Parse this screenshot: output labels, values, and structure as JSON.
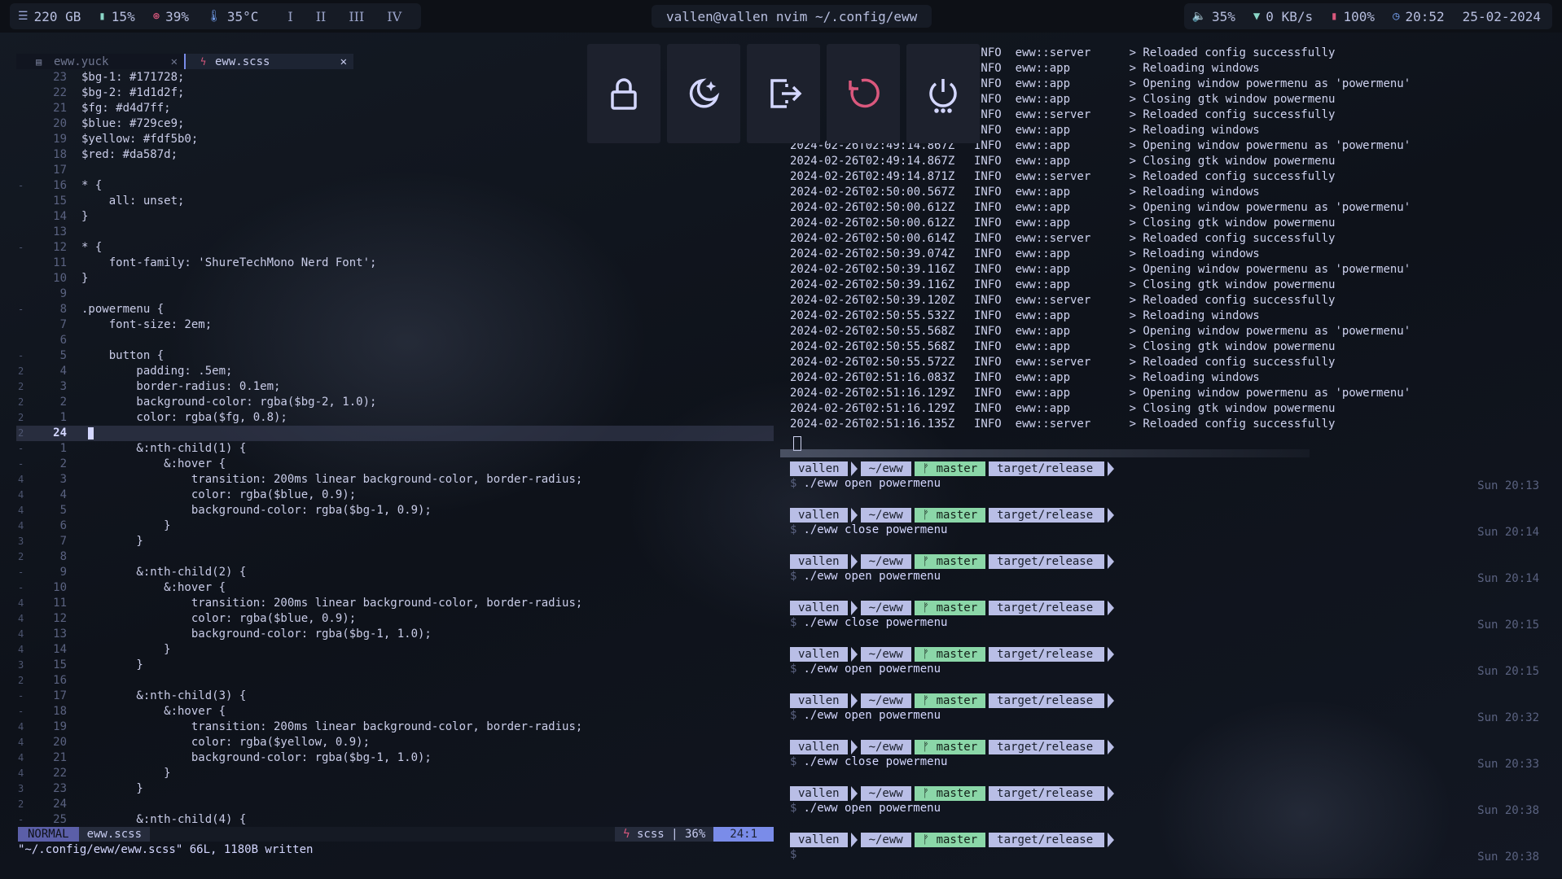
{
  "topbar": {
    "disk": "220 GB",
    "ram": "15%",
    "cpu": "39%",
    "temp": "35°C",
    "workspaces": [
      "I",
      "II",
      "III",
      "IV"
    ],
    "window_title": "vallen@vallen nvim ~/.config/eww",
    "volume": "35%",
    "network": "0 KB/s",
    "battery": "100%",
    "time": "20:52",
    "date": "25-02-2024"
  },
  "editor": {
    "tabs": [
      {
        "label": "eww.yuck",
        "close": "✕"
      },
      {
        "label": "eww.scss",
        "close": "✕"
      }
    ],
    "lines": [
      {
        "sign": "",
        "num": "23",
        "text": "$bg-1: #171728;"
      },
      {
        "sign": "",
        "num": "22",
        "text": "$bg-2: #1d1d2f;"
      },
      {
        "sign": "",
        "num": "21",
        "text": "$fg: #d4d7ff;"
      },
      {
        "sign": "",
        "num": "20",
        "text": "$blue: #729ce9;"
      },
      {
        "sign": "",
        "num": "19",
        "text": "$yellow: #fdf5b0;"
      },
      {
        "sign": "",
        "num": "18",
        "text": "$red: #da587d;"
      },
      {
        "sign": "",
        "num": "17",
        "text": ""
      },
      {
        "sign": "-",
        "num": "16",
        "text": "* {"
      },
      {
        "sign": "",
        "num": "15",
        "text": "    all: unset;"
      },
      {
        "sign": "",
        "num": "14",
        "text": "}"
      },
      {
        "sign": "",
        "num": "13",
        "text": ""
      },
      {
        "sign": "-",
        "num": "12",
        "text": "* {"
      },
      {
        "sign": "",
        "num": "11",
        "text": "    font-family: 'ShureTechMono Nerd Font';"
      },
      {
        "sign": "",
        "num": "10",
        "text": "}"
      },
      {
        "sign": "",
        "num": "9",
        "text": ""
      },
      {
        "sign": "-",
        "num": "8",
        "text": ".powermenu {"
      },
      {
        "sign": "",
        "num": "7",
        "text": "    font-size: 2em;"
      },
      {
        "sign": "",
        "num": "6",
        "text": ""
      },
      {
        "sign": "-",
        "num": "5",
        "text": "    button {"
      },
      {
        "sign": "2",
        "num": "4",
        "text": "        padding: .5em;"
      },
      {
        "sign": "2",
        "num": "3",
        "text": "        border-radius: 0.1em;"
      },
      {
        "sign": "2",
        "num": "2",
        "text": "        background-color: rgba($bg-2, 1.0);"
      },
      {
        "sign": "2",
        "num": "1",
        "text": "        color: rgba($fg, 0.8);"
      },
      {
        "sign": "2",
        "num": "24",
        "text": "",
        "current": true
      },
      {
        "sign": "-",
        "num": "1",
        "text": "        &:nth-child(1) {"
      },
      {
        "sign": "-",
        "num": "2",
        "text": "            &:hover {"
      },
      {
        "sign": "4",
        "num": "3",
        "text": "                transition: 200ms linear background-color, border-radius;"
      },
      {
        "sign": "4",
        "num": "4",
        "text": "                color: rgba($blue, 0.9);"
      },
      {
        "sign": "4",
        "num": "5",
        "text": "                background-color: rgba($bg-1, 0.9);"
      },
      {
        "sign": "4",
        "num": "6",
        "text": "            }"
      },
      {
        "sign": "3",
        "num": "7",
        "text": "        }"
      },
      {
        "sign": "2",
        "num": "8",
        "text": ""
      },
      {
        "sign": "-",
        "num": "9",
        "text": "        &:nth-child(2) {"
      },
      {
        "sign": "-",
        "num": "10",
        "text": "            &:hover {"
      },
      {
        "sign": "4",
        "num": "11",
        "text": "                transition: 200ms linear background-color, border-radius;"
      },
      {
        "sign": "4",
        "num": "12",
        "text": "                color: rgba($blue, 0.9);"
      },
      {
        "sign": "4",
        "num": "13",
        "text": "                background-color: rgba($bg-1, 1.0);"
      },
      {
        "sign": "4",
        "num": "14",
        "text": "            }"
      },
      {
        "sign": "3",
        "num": "15",
        "text": "        }"
      },
      {
        "sign": "2",
        "num": "16",
        "text": ""
      },
      {
        "sign": "-",
        "num": "17",
        "text": "        &:nth-child(3) {"
      },
      {
        "sign": "-",
        "num": "18",
        "text": "            &:hover {"
      },
      {
        "sign": "4",
        "num": "19",
        "text": "                transition: 200ms linear background-color, border-radius;"
      },
      {
        "sign": "4",
        "num": "20",
        "text": "                color: rgba($yellow, 0.9);"
      },
      {
        "sign": "4",
        "num": "21",
        "text": "                background-color: rgba($bg-1, 1.0);"
      },
      {
        "sign": "4",
        "num": "22",
        "text": "            }"
      },
      {
        "sign": "3",
        "num": "23",
        "text": "        }"
      },
      {
        "sign": "2",
        "num": "24",
        "text": ""
      },
      {
        "sign": "-",
        "num": "25",
        "text": "        &:nth-child(4) {"
      }
    ],
    "status": {
      "mode": "NORMAL",
      "file": "eww.scss",
      "filetype": "scss",
      "percent": "36%",
      "position": "24:1"
    },
    "cmdline": "\"~/.config/eww/eww.scss\" 66L, 1180B written"
  },
  "log": [
    {
      "ts": "",
      "level": "INFO",
      "mod": "eww::server",
      "msg": "> Reloaded config successfully"
    },
    {
      "ts": "",
      "level": "INFO",
      "mod": "eww::app",
      "msg": "> Reloading windows"
    },
    {
      "ts": "",
      "level": "INFO",
      "mod": "eww::app",
      "msg": "> Opening window powermenu as 'powermenu'"
    },
    {
      "ts": "",
      "level": "INFO",
      "mod": "eww::app",
      "msg": "> Closing gtk window powermenu"
    },
    {
      "ts": "",
      "level": "INFO",
      "mod": "eww::server",
      "msg": "> Reloaded config successfully"
    },
    {
      "ts": "",
      "level": "INFO",
      "mod": "eww::app",
      "msg": "> Reloading windows"
    },
    {
      "ts": "2024-02-26T02:49:14.867Z",
      "level": "INFO",
      "mod": "eww::app",
      "msg": "> Opening window powermenu as 'powermenu'"
    },
    {
      "ts": "2024-02-26T02:49:14.867Z",
      "level": "INFO",
      "mod": "eww::app",
      "msg": "> Closing gtk window powermenu"
    },
    {
      "ts": "2024-02-26T02:49:14.871Z",
      "level": "INFO",
      "mod": "eww::server",
      "msg": "> Reloaded config successfully"
    },
    {
      "ts": "2024-02-26T02:50:00.567Z",
      "level": "INFO",
      "mod": "eww::app",
      "msg": "> Reloading windows"
    },
    {
      "ts": "2024-02-26T02:50:00.612Z",
      "level": "INFO",
      "mod": "eww::app",
      "msg": "> Opening window powermenu as 'powermenu'"
    },
    {
      "ts": "2024-02-26T02:50:00.612Z",
      "level": "INFO",
      "mod": "eww::app",
      "msg": "> Closing gtk window powermenu"
    },
    {
      "ts": "2024-02-26T02:50:00.614Z",
      "level": "INFO",
      "mod": "eww::server",
      "msg": "> Reloaded config successfully"
    },
    {
      "ts": "2024-02-26T02:50:39.074Z",
      "level": "INFO",
      "mod": "eww::app",
      "msg": "> Reloading windows"
    },
    {
      "ts": "2024-02-26T02:50:39.116Z",
      "level": "INFO",
      "mod": "eww::app",
      "msg": "> Opening window powermenu as 'powermenu'"
    },
    {
      "ts": "2024-02-26T02:50:39.116Z",
      "level": "INFO",
      "mod": "eww::app",
      "msg": "> Closing gtk window powermenu"
    },
    {
      "ts": "2024-02-26T02:50:39.120Z",
      "level": "INFO",
      "mod": "eww::server",
      "msg": "> Reloaded config successfully"
    },
    {
      "ts": "2024-02-26T02:50:55.532Z",
      "level": "INFO",
      "mod": "eww::app",
      "msg": "> Reloading windows"
    },
    {
      "ts": "2024-02-26T02:50:55.568Z",
      "level": "INFO",
      "mod": "eww::app",
      "msg": "> Opening window powermenu as 'powermenu'"
    },
    {
      "ts": "2024-02-26T02:50:55.568Z",
      "level": "INFO",
      "mod": "eww::app",
      "msg": "> Closing gtk window powermenu"
    },
    {
      "ts": "2024-02-26T02:50:55.572Z",
      "level": "INFO",
      "mod": "eww::server",
      "msg": "> Reloaded config successfully"
    },
    {
      "ts": "2024-02-26T02:51:16.083Z",
      "level": "INFO",
      "mod": "eww::app",
      "msg": "> Reloading windows"
    },
    {
      "ts": "2024-02-26T02:51:16.129Z",
      "level": "INFO",
      "mod": "eww::app",
      "msg": "> Opening window powermenu as 'powermenu'"
    },
    {
      "ts": "2024-02-26T02:51:16.129Z",
      "level": "INFO",
      "mod": "eww::app",
      "msg": "> Closing gtk window powermenu"
    },
    {
      "ts": "2024-02-26T02:51:16.135Z",
      "level": "INFO",
      "mod": "eww::server",
      "msg": "> Reloaded config successfully"
    }
  ],
  "prompts": [
    {
      "user": "vallen",
      "dir": "~/eww",
      "branch": "master",
      "target": "target/release",
      "cmd": "./eww open powermenu",
      "time": "Sun 20:13"
    },
    {
      "user": "vallen",
      "dir": "~/eww",
      "branch": "master",
      "target": "target/release",
      "cmd": "./eww close powermenu",
      "time": "Sun 20:14"
    },
    {
      "user": "vallen",
      "dir": "~/eww",
      "branch": "master",
      "target": "target/release",
      "cmd": "./eww open powermenu",
      "time": "Sun 20:14"
    },
    {
      "user": "vallen",
      "dir": "~/eww",
      "branch": "master",
      "target": "target/release",
      "cmd": "./eww close powermenu",
      "time": "Sun 20:15"
    },
    {
      "user": "vallen",
      "dir": "~/eww",
      "branch": "master",
      "target": "target/release",
      "cmd": "./eww open powermenu",
      "time": "Sun 20:15"
    },
    {
      "user": "vallen",
      "dir": "~/eww",
      "branch": "master",
      "target": "target/release",
      "cmd": "./eww open powermenu",
      "time": "Sun 20:32"
    },
    {
      "user": "vallen",
      "dir": "~/eww",
      "branch": "master",
      "target": "target/release",
      "cmd": "./eww close powermenu",
      "time": "Sun 20:33"
    },
    {
      "user": "vallen",
      "dir": "~/eww",
      "branch": "master",
      "target": "target/release",
      "cmd": "./eww open powermenu",
      "time": "Sun 20:38"
    },
    {
      "user": "vallen",
      "dir": "~/eww",
      "branch": "master",
      "target": "target/release",
      "cmd": "",
      "time": "Sun 20:38"
    }
  ],
  "powermenu": {
    "buttons": [
      "lock-icon",
      "sleep-icon",
      "logout-icon",
      "reboot-icon",
      "shutdown-icon"
    ],
    "colors": {
      "fg": "#d4d7ff",
      "blue": "#729ce9",
      "yellow": "#fdf5b0",
      "red": "#da587d",
      "bg": "#1d1d2f"
    }
  },
  "prompt_symbol": "$",
  "branch_glyph": "ᚠ"
}
